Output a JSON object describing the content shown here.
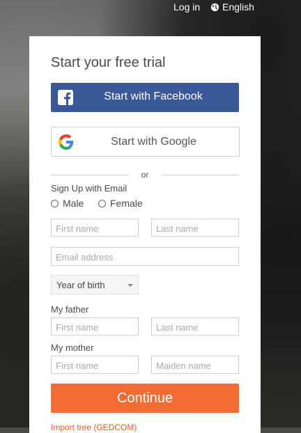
{
  "topbar": {
    "login_label": "Log in",
    "language_label": "English"
  },
  "form": {
    "title": "Start your free trial",
    "facebook_button": "Start with Facebook",
    "google_button": "Start with Google",
    "divider_text": "or",
    "signup_email_label": "Sign Up with Email",
    "gender_options": [
      "Male",
      "Female"
    ],
    "first_name_placeholder": "First name",
    "last_name_placeholder": "Last name",
    "email_placeholder": "Email address",
    "birth_year_select": "Year of birth",
    "father_label": "My father",
    "father_first_placeholder": "First name",
    "father_last_placeholder": "Last name",
    "mother_label": "My mother",
    "mother_first_placeholder": "First name",
    "mother_maiden_placeholder": "Maiden name",
    "continue_button": "Continue",
    "import_link": "Import tree (GEDCOM)"
  },
  "colors": {
    "facebook": "#3b5998",
    "accent": "#f26b33"
  },
  "icons": [
    "globe-icon",
    "facebook-icon",
    "google-icon",
    "chevron-down-icon"
  ]
}
